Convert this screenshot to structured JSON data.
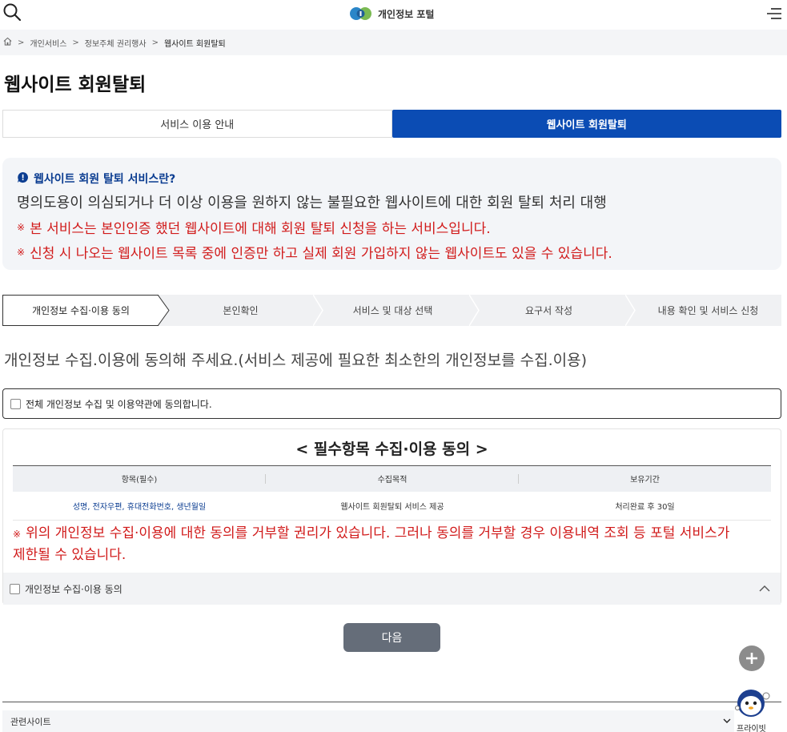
{
  "header": {
    "logo_text": "개인정보 포털"
  },
  "breadcrumb": {
    "items": [
      "개인서비스",
      "정보주체 권리행사",
      "웹사이트 회원탈퇴"
    ]
  },
  "page": {
    "title": "웹사이트 회원탈퇴"
  },
  "tabs": [
    {
      "label": "서비스 이용 안내",
      "active": false
    },
    {
      "label": "웹사이트 회원탈퇴",
      "active": true
    }
  ],
  "info": {
    "title": "웹사이트 회원 탈퇴 서비스란?",
    "description": "명의도용이 의심되거나 더 이상 이용을 원하지 않는 불필요한 웹사이트에 대한 회원 탈퇴 처리 대행",
    "notes": [
      "본 서비스는 본인인증 했던 웹사이트에 대해 회원 탈퇴 신청을 하는 서비스입니다.",
      "신청 시 나오는 웹사이트 목록 중에 인증만 하고 실제 회원 가입하지 않는 웹사이트도 있을 수 있습니다."
    ],
    "note_mark": "※"
  },
  "steps": [
    {
      "label": "개인정보 수집·이용 동의",
      "active": true
    },
    {
      "label": "본인확인",
      "active": false
    },
    {
      "label": "서비스 및 대상 선택",
      "active": false
    },
    {
      "label": "요구서 작성",
      "active": false
    },
    {
      "label": "내용 확인 및 서비스 신청",
      "active": false
    }
  ],
  "consent": {
    "heading": "개인정보 수집.이용에 동의해 주세요.(서비스 제공에 필요한 최소한의 개인정보를 수집.이용)",
    "agree_all_label": "전체 개인정보 수집 및 이용약관에 동의합니다.",
    "terms_title": "< 필수항목 수집·이용 동의 >",
    "table_headers": [
      "항목(필수)",
      "수집목적",
      "보유기간"
    ],
    "table_row": [
      "성명, 전자우편, 휴대전화번호, 생년월일",
      "웹사이트 회원탈퇴 서비스 제공",
      "처리완료 후 30일"
    ],
    "warning_line1": "위의 개인정보 수집·이용에 대한 동의를 거부할 권리가 있습니다. 그러나 동의를 거부할 경우 이용내역 조회 등 포털 서비스가",
    "warning_line2": "제한될 수 있습니다.",
    "agree_item_label": "개인정보 수집·이용 동의"
  },
  "next_button": "다음",
  "related_sites": "관련사이트",
  "chatbot_label": "프라이빗",
  "colors": {
    "brand_blue": "#0b4cb4",
    "warning_red": "#d11a1a",
    "button_gray": "#656d79"
  }
}
